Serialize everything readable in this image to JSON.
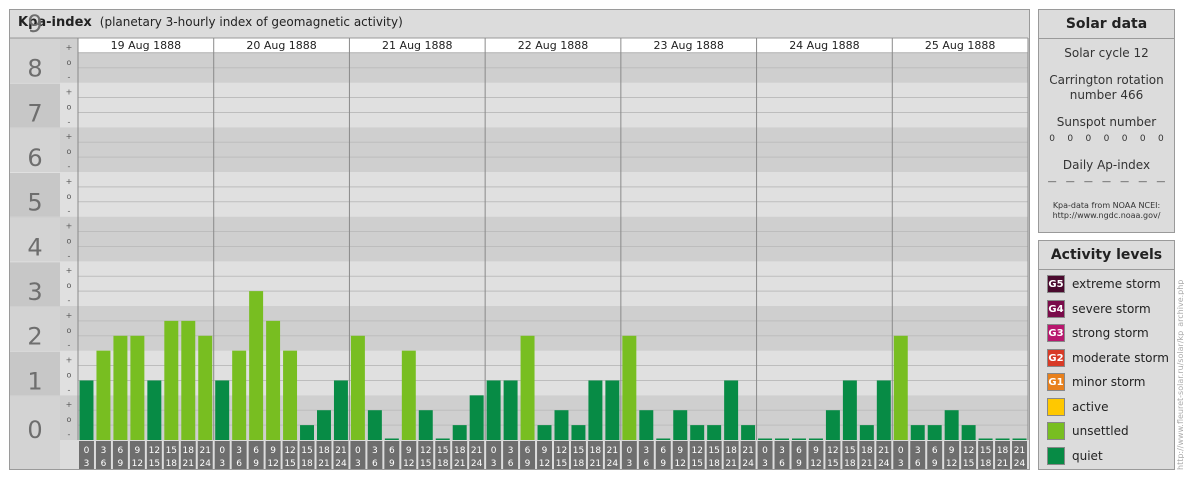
{
  "header": {
    "title": "Kpa-index",
    "subtitle": "(planetary 3-hourly index of geomagnetic activity)"
  },
  "chart_data": {
    "type": "bar",
    "title": "Kpa-index",
    "subtitle": "(planetary 3-hourly index of geomagnetic activity)",
    "ylim": [
      0,
      9
    ],
    "y_ticks": [
      "0",
      "1",
      "2",
      "3",
      "4",
      "5",
      "6",
      "7",
      "8",
      "9"
    ],
    "subticks": [
      "-",
      "o",
      "+"
    ],
    "days": [
      "19 Aug 1888",
      "20 Aug 1888",
      "21 Aug 1888",
      "22 Aug 1888",
      "23 Aug 1888",
      "24 Aug 1888",
      "25 Aug 1888"
    ],
    "slots": [
      [
        "0",
        "3"
      ],
      [
        "3",
        "6"
      ],
      [
        "6",
        "9"
      ],
      [
        "9",
        "12"
      ],
      [
        "12",
        "15"
      ],
      [
        "15",
        "18"
      ],
      [
        "18",
        "21"
      ],
      [
        "21",
        "24"
      ]
    ],
    "values": [
      1.333,
      2.0,
      2.333,
      2.333,
      1.333,
      2.667,
      2.667,
      2.333,
      1.333,
      2.0,
      3.333,
      2.667,
      2.0,
      0.333,
      0.667,
      1.333,
      2.333,
      0.667,
      0.0,
      2.0,
      0.667,
      0.0,
      0.333,
      1.0,
      1.333,
      1.333,
      2.333,
      0.333,
      0.667,
      0.333,
      1.333,
      1.333,
      2.333,
      0.667,
      0.0,
      0.667,
      0.333,
      0.333,
      1.333,
      0.333,
      0.0,
      0.0,
      0.0,
      0.0,
      0.667,
      1.333,
      0.333,
      1.333,
      2.333,
      0.333,
      0.333,
      0.667,
      0.333,
      0.0,
      0.0,
      0.0
    ],
    "colors": {
      "quiet": "#078b45",
      "unsettled": "#78be21",
      "active": "#ffc800",
      "minor_storm": "#e8801c",
      "moderate_storm": "#d83a26",
      "strong_storm": "#b8176e",
      "severe_storm": "#7a0b4a",
      "extreme_storm": "#4a0a2e"
    },
    "background_bands": [
      "#cfcfcf",
      "#e0e0e0"
    ],
    "tick_box_color": "#6e6e6e"
  },
  "solar": {
    "heading": "Solar data",
    "cycle": "Solar cycle 12",
    "carrington_1": "Carrington rotation",
    "carrington_2": "number 466",
    "sunspot_label": "Sunspot number",
    "sunspots": [
      "0",
      "0",
      "0",
      "0",
      "0",
      "0",
      "0"
    ],
    "ap_label": "Daily Ap-index",
    "ap": [
      "—",
      "—",
      "—",
      "—",
      "—",
      "—",
      "—"
    ],
    "source_1": "Kpa-data from NOAA NCEI:",
    "source_2": "http://www.ngdc.noaa.gov/"
  },
  "levels": {
    "heading": "Activity levels",
    "items": [
      {
        "badge": "G5",
        "label": "extreme storm",
        "color": "#4a0a2e"
      },
      {
        "badge": "G4",
        "label": "severe storm",
        "color": "#7a0b4a"
      },
      {
        "badge": "G3",
        "label": "strong storm",
        "color": "#b8176e"
      },
      {
        "badge": "G2",
        "label": "moderate storm",
        "color": "#d83a26"
      },
      {
        "badge": "G1",
        "label": "minor storm",
        "color": "#e8801c"
      },
      {
        "badge": "",
        "label": "active",
        "color": "#ffc800"
      },
      {
        "badge": "",
        "label": "unsettled",
        "color": "#78be21"
      },
      {
        "badge": "",
        "label": "quiet",
        "color": "#078b45"
      }
    ]
  },
  "watermark": "http://www.fleuret-solar.ru/solar/kp_archive.php"
}
